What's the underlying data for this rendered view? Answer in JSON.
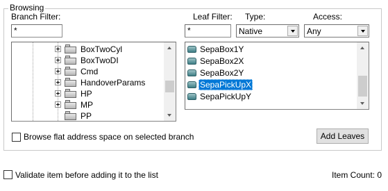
{
  "browsing": {
    "title": "Browsing",
    "branch_filter": {
      "label": "Branch Filter:",
      "value": "*"
    },
    "leaf_filter": {
      "label": "Leaf Filter:",
      "value": "*"
    },
    "type": {
      "label": "Type:",
      "value": "Native"
    },
    "access": {
      "label": "Access:",
      "value": "Any"
    },
    "tree_items": [
      {
        "label": "BoxTwoCyl",
        "expandable": true
      },
      {
        "label": "BoxTwoDI",
        "expandable": true
      },
      {
        "label": "Cmd",
        "expandable": true
      },
      {
        "label": "HandoverParams",
        "expandable": true
      },
      {
        "label": "HP",
        "expandable": true
      },
      {
        "label": "MP",
        "expandable": true
      },
      {
        "label": "PP",
        "expandable": false
      }
    ],
    "leaves": [
      {
        "label": "SepaBox1Y",
        "selected": false
      },
      {
        "label": "SepaBox2X",
        "selected": false
      },
      {
        "label": "SepaBox2Y",
        "selected": false
      },
      {
        "label": "SepaPickUpX",
        "selected": true
      },
      {
        "label": "SepaPickUpY",
        "selected": false
      }
    ],
    "flat_checkbox_label": "Browse flat address space on selected branch",
    "add_leaves_label": "Add Leaves"
  },
  "validate_checkbox_label": "Validate item before adding it to the list",
  "item_count": "Item Count: 0",
  "colors": {
    "selection": "#0078d7",
    "leaf_icon": "#3f7f86"
  },
  "icons": {
    "folder": "folder-icon",
    "leaf": "leaf-tag-icon"
  }
}
